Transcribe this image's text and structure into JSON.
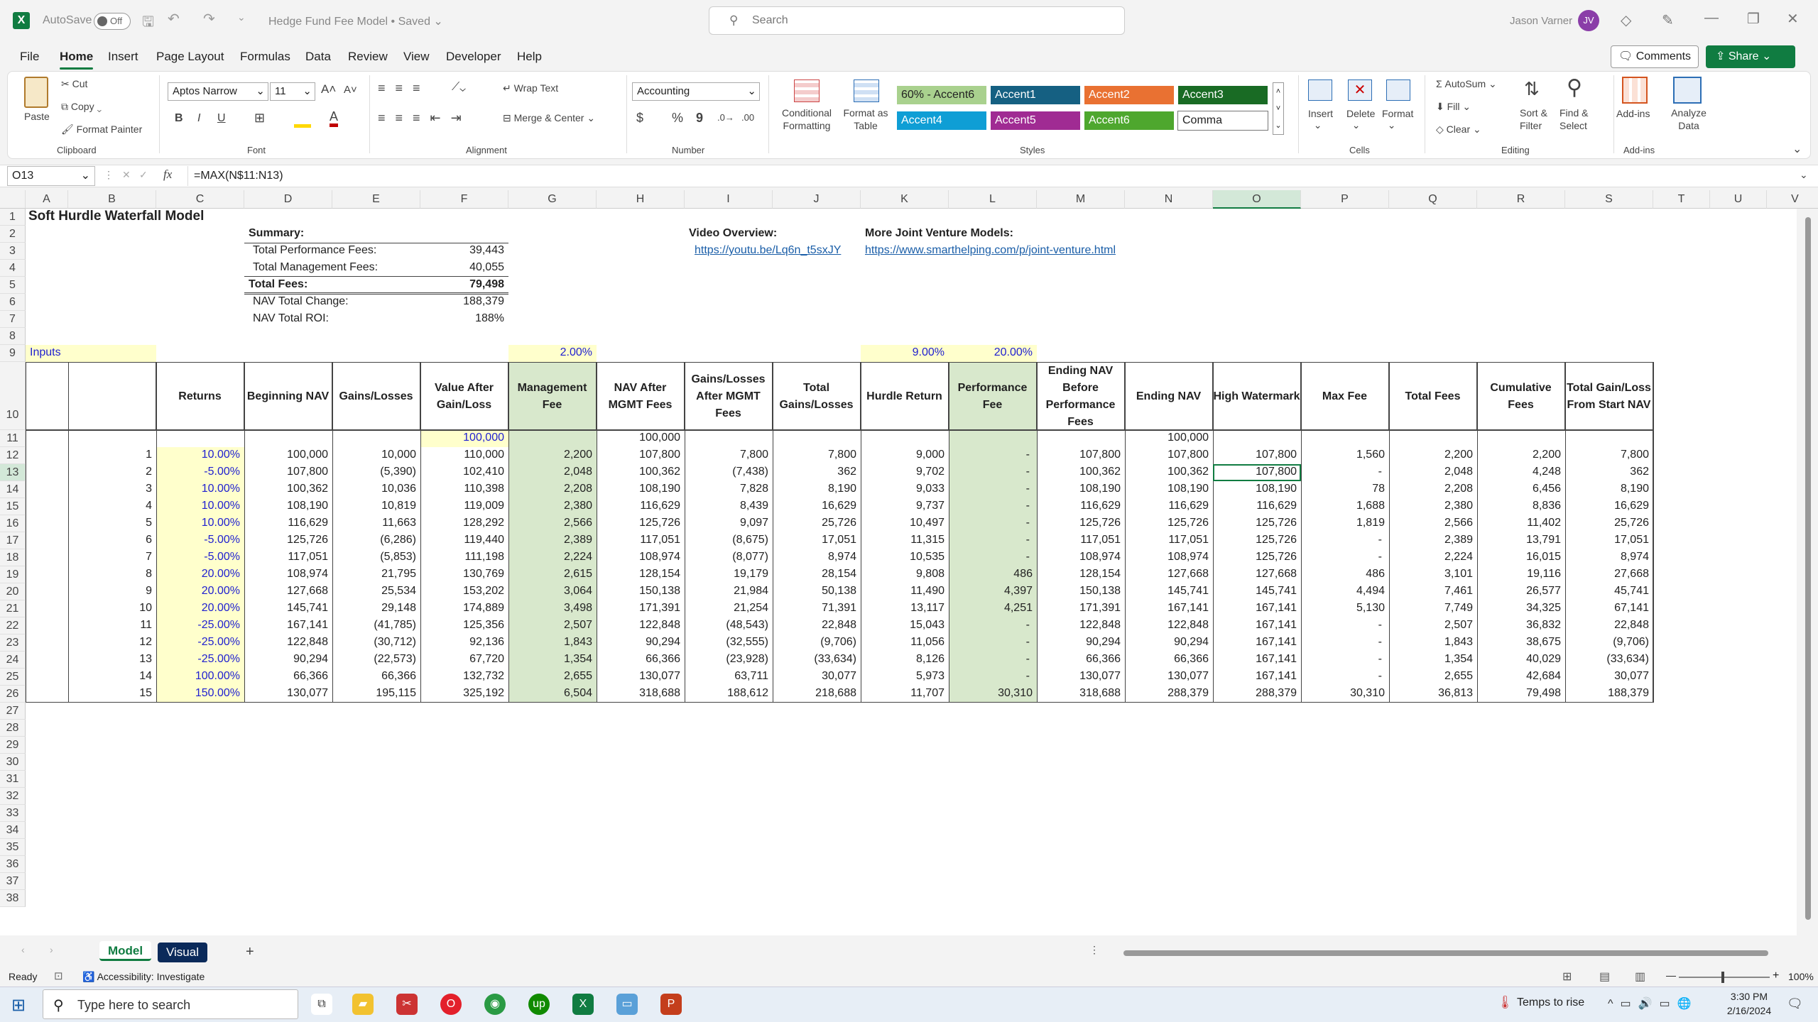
{
  "titlebar": {
    "autosave_label": "AutoSave",
    "autosave_state": "Off",
    "doc_title": "Hedge Fund Fee Model",
    "doc_status": "Saved",
    "search_placeholder": "Search",
    "user_name": "Jason Varner",
    "user_initials": "JV"
  },
  "menu_tabs": [
    "File",
    "Home",
    "Insert",
    "Page Layout",
    "Formulas",
    "Data",
    "Review",
    "View",
    "Developer",
    "Help"
  ],
  "active_tab": "Home",
  "buttons": {
    "comments": "Comments",
    "share": "Share"
  },
  "ribbon": {
    "clipboard": {
      "paste": "Paste",
      "cut": "Cut",
      "copy": "Copy",
      "format_painter": "Format Painter",
      "group": "Clipboard"
    },
    "font": {
      "name": "Aptos Narrow",
      "size": "11",
      "bold": "B",
      "italic": "I",
      "underline": "U",
      "group": "Font"
    },
    "alignment": {
      "wrap_text": "Wrap Text",
      "merge_center": "Merge & Center",
      "group": "Alignment"
    },
    "number": {
      "format": "Accounting",
      "currency": "$",
      "percent": "%",
      "comma": "9",
      "group": "Number"
    },
    "styles": {
      "conditional": "Conditional Formatting",
      "format_table": "Format as Table",
      "cells": [
        "60% - Accent6",
        "Accent1",
        "Accent2",
        "Accent3",
        "Accent4",
        "Accent5",
        "Accent6",
        "Comma"
      ],
      "group": "Styles"
    },
    "cells": {
      "insert": "Insert",
      "delete": "Delete",
      "format": "Format",
      "group": "Cells"
    },
    "editing": {
      "autosum": "AutoSum",
      "fill": "Fill",
      "clear": "Clear",
      "sort_filter": "Sort & Filter",
      "find_select": "Find & Select",
      "group": "Editing"
    },
    "addins": {
      "addins": "Add-ins",
      "analyze": "Analyze Data",
      "group": "Add-ins"
    }
  },
  "formula_bar": {
    "name_box": "O13",
    "formula": "=MAX(N$11:N13)"
  },
  "columns": [
    "A",
    "B",
    "C",
    "D",
    "E",
    "F",
    "G",
    "H",
    "I",
    "J",
    "K",
    "L",
    "M",
    "N",
    "O",
    "P",
    "Q",
    "R",
    "S",
    "T",
    "U",
    "V"
  ],
  "sheet": {
    "title": "Soft Hurdle Waterfall Model",
    "summary_label": "Summary:",
    "summary": [
      {
        "label": "Total Performance Fees:",
        "value": "39,443"
      },
      {
        "label": "Total Management Fees:",
        "value": "40,055"
      },
      {
        "label": "Total Fees:",
        "value": "79,498"
      },
      {
        "label": "NAV Total Change:",
        "value": "188,379"
      },
      {
        "label": "NAV Total ROI:",
        "value": "188%"
      }
    ],
    "video_label": "Video Overview:",
    "video_link": "https://youtu.be/Lq6n_t5sxJY",
    "more_label": "More Joint Venture Models:",
    "more_link": "https://www.smarthelping.com/p/joint-venture.html",
    "inputs_label": "Inputs",
    "mgmt_rate": "2.00%",
    "hurdle_rate": "9.00%",
    "perf_rate": "20.00%",
    "headers": [
      "Returns",
      "Beginning NAV",
      "Gains/Losses",
      "Value After Gain/Loss",
      "Management Fee",
      "NAV After MGMT Fees",
      "Gains/Losses After MGMT Fees",
      "Total Gains/Losses",
      "Hurdle Return",
      "Performance Fee",
      "Ending NAV Before Performance Fees",
      "Ending NAV",
      "High Watermark",
      "Max Fee",
      "Total Fees",
      "Cumulative Fees",
      "Total Gain/Loss From Start NAV"
    ],
    "start_value": "100,000",
    "start_nav_after": "100,000",
    "start_ending": "100,000",
    "rows": [
      [
        "1",
        "10.00%",
        "100,000",
        "10,000",
        "110,000",
        "2,200",
        "107,800",
        "7,800",
        "7,800",
        "9,000",
        "-",
        "107,800",
        "107,800",
        "107,800",
        "1,560",
        "2,200",
        "2,200",
        "7,800"
      ],
      [
        "2",
        "-5.00%",
        "107,800",
        "(5,390)",
        "102,410",
        "2,048",
        "100,362",
        "(7,438)",
        "362",
        "9,702",
        "-",
        "100,362",
        "100,362",
        "107,800",
        "-",
        "2,048",
        "4,248",
        "362"
      ],
      [
        "3",
        "10.00%",
        "100,362",
        "10,036",
        "110,398",
        "2,208",
        "108,190",
        "7,828",
        "8,190",
        "9,033",
        "-",
        "108,190",
        "108,190",
        "108,190",
        "78",
        "2,208",
        "6,456",
        "8,190"
      ],
      [
        "4",
        "10.00%",
        "108,190",
        "10,819",
        "119,009",
        "2,380",
        "116,629",
        "8,439",
        "16,629",
        "9,737",
        "-",
        "116,629",
        "116,629",
        "116,629",
        "1,688",
        "2,380",
        "8,836",
        "16,629"
      ],
      [
        "5",
        "10.00%",
        "116,629",
        "11,663",
        "128,292",
        "2,566",
        "125,726",
        "9,097",
        "25,726",
        "10,497",
        "-",
        "125,726",
        "125,726",
        "125,726",
        "1,819",
        "2,566",
        "11,402",
        "25,726"
      ],
      [
        "6",
        "-5.00%",
        "125,726",
        "(6,286)",
        "119,440",
        "2,389",
        "117,051",
        "(8,675)",
        "17,051",
        "11,315",
        "-",
        "117,051",
        "117,051",
        "125,726",
        "-",
        "2,389",
        "13,791",
        "17,051"
      ],
      [
        "7",
        "-5.00%",
        "117,051",
        "(5,853)",
        "111,198",
        "2,224",
        "108,974",
        "(8,077)",
        "8,974",
        "10,535",
        "-",
        "108,974",
        "108,974",
        "125,726",
        "-",
        "2,224",
        "16,015",
        "8,974"
      ],
      [
        "8",
        "20.00%",
        "108,974",
        "21,795",
        "130,769",
        "2,615",
        "128,154",
        "19,179",
        "28,154",
        "9,808",
        "486",
        "128,154",
        "127,668",
        "127,668",
        "486",
        "3,101",
        "19,116",
        "27,668"
      ],
      [
        "9",
        "20.00%",
        "127,668",
        "25,534",
        "153,202",
        "3,064",
        "150,138",
        "21,984",
        "50,138",
        "11,490",
        "4,397",
        "150,138",
        "145,741",
        "145,741",
        "4,494",
        "7,461",
        "26,577",
        "45,741"
      ],
      [
        "10",
        "20.00%",
        "145,741",
        "29,148",
        "174,889",
        "3,498",
        "171,391",
        "21,254",
        "71,391",
        "13,117",
        "4,251",
        "171,391",
        "167,141",
        "167,141",
        "5,130",
        "7,749",
        "34,325",
        "67,141"
      ],
      [
        "11",
        "-25.00%",
        "167,141",
        "(41,785)",
        "125,356",
        "2,507",
        "122,848",
        "(48,543)",
        "22,848",
        "15,043",
        "-",
        "122,848",
        "122,848",
        "167,141",
        "-",
        "2,507",
        "36,832",
        "22,848"
      ],
      [
        "12",
        "-25.00%",
        "122,848",
        "(30,712)",
        "92,136",
        "1,843",
        "90,294",
        "(32,555)",
        "(9,706)",
        "11,056",
        "-",
        "90,294",
        "90,294",
        "167,141",
        "-",
        "1,843",
        "38,675",
        "(9,706)"
      ],
      [
        "13",
        "-25.00%",
        "90,294",
        "(22,573)",
        "67,720",
        "1,354",
        "66,366",
        "(23,928)",
        "(33,634)",
        "8,126",
        "-",
        "66,366",
        "66,366",
        "167,141",
        "-",
        "1,354",
        "40,029",
        "(33,634)"
      ],
      [
        "14",
        "100.00%",
        "66,366",
        "66,366",
        "132,732",
        "2,655",
        "130,077",
        "63,711",
        "30,077",
        "5,973",
        "-",
        "130,077",
        "130,077",
        "167,141",
        "-",
        "2,655",
        "42,684",
        "30,077"
      ],
      [
        "15",
        "150.00%",
        "130,077",
        "195,115",
        "325,192",
        "6,504",
        "318,688",
        "188,612",
        "218,688",
        "11,707",
        "30,310",
        "318,688",
        "288,379",
        "288,379",
        "30,310",
        "36,813",
        "79,498",
        "188,379"
      ]
    ]
  },
  "sheet_tabs": [
    "Model",
    "Visual"
  ],
  "status": {
    "ready": "Ready",
    "accessibility": "Accessibility: Investigate",
    "zoom": "100%"
  },
  "taskbar": {
    "search_placeholder": "Type here to search",
    "weather": "Temps to rise",
    "time": "3:30 PM",
    "date": "2/16/2024"
  }
}
